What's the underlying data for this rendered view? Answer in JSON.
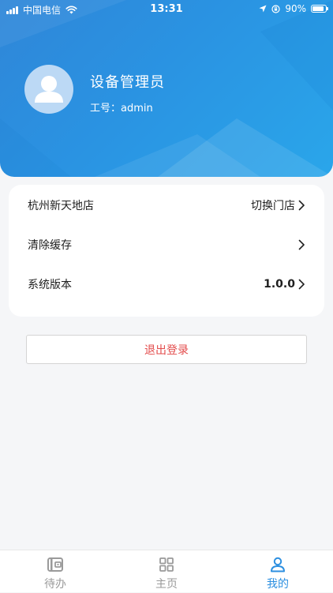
{
  "status_bar": {
    "carrier": "中国电信",
    "time": "13:31",
    "battery": "90%",
    "battery_level": 0.9
  },
  "profile": {
    "name": "设备管理员",
    "id_label": "工号：admin"
  },
  "settings": {
    "rows": [
      {
        "label": "杭州新天地店",
        "value": "切换门店"
      },
      {
        "label": "清除缓存",
        "value": ""
      },
      {
        "label": "系统版本",
        "value": "1.0.0"
      }
    ]
  },
  "logout_label": "退出登录",
  "tabbar": {
    "tabs": [
      {
        "label": "待办",
        "icon": "wallet-icon"
      },
      {
        "label": "主页",
        "icon": "grid-icon"
      },
      {
        "label": "我的",
        "icon": "user-icon"
      }
    ],
    "active": "我的"
  },
  "colors": {
    "header_blue": "#2a93e2",
    "accent": "#2c8fe0",
    "logout_red": "#e34b4b"
  }
}
